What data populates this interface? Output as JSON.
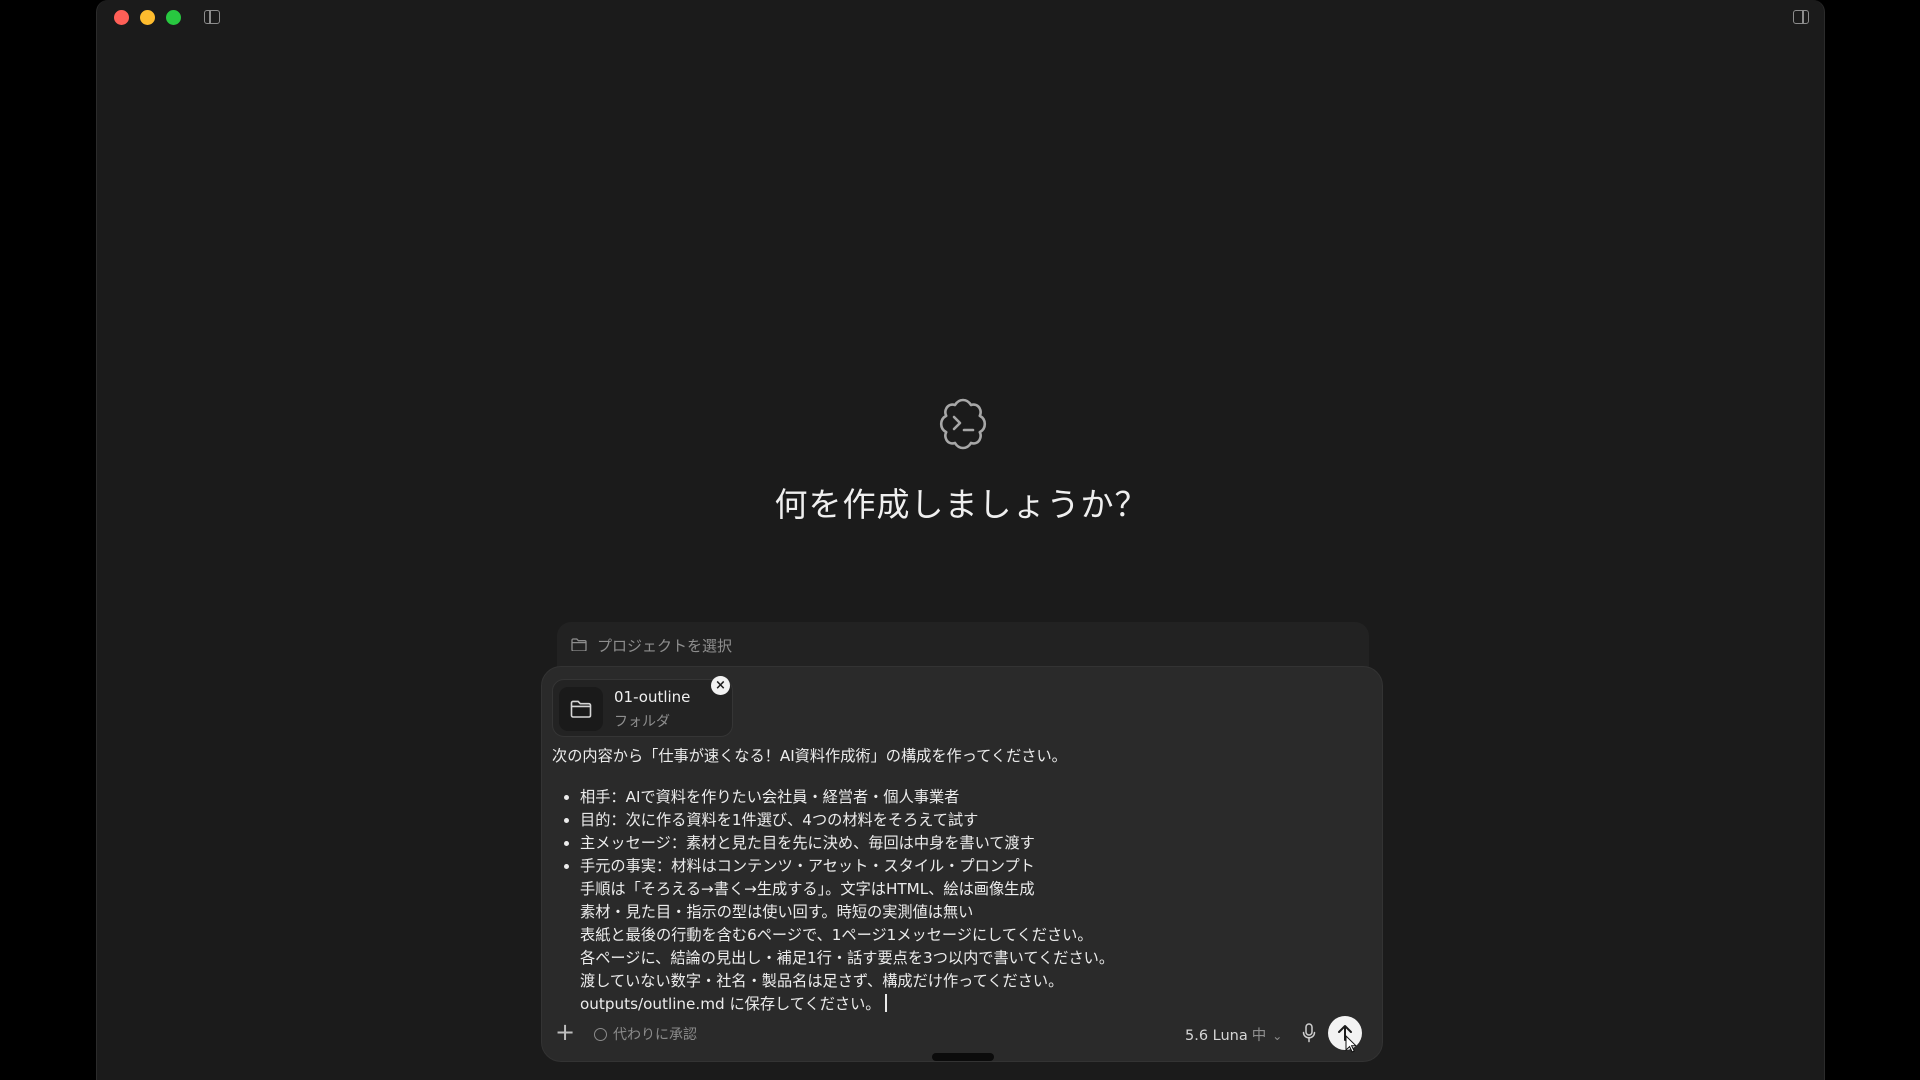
{
  "window": {
    "controls": [
      "close",
      "minimize",
      "maximize"
    ]
  },
  "hero": {
    "logo_icon": "terminal-cloud-icon",
    "headline": "何を作成しましょうか？"
  },
  "project": {
    "icon": "folder-icon",
    "placeholder": "プロジェクトを選択"
  },
  "attachment": {
    "name": "01-outline",
    "kind": "フォルダ",
    "icon": "folder-icon",
    "remove_icon": "close-icon"
  },
  "prompt": {
    "intro": "次の内容から「仕事が速くなる！AI資料作成術」の構成を作ってください。",
    "bullets": [
      "相手：AIで資料を作りたい会社員・経営者・個人事業者",
      "目的：次に作る資料を1件選び、4つの材料をそろえて試す",
      "主メッセージ：素材と見た目を先に決め、毎回は中身を書いて渡す",
      "手元の事実：材料はコンテンツ・アセット・スタイル・プロンプト"
    ],
    "continuation": [
      "手順は「そろえる→書く→生成する」。文字はHTML、絵は画像生成",
      "素材・見た目・指示の型は使い回す。時短の実測値は無い",
      "表紙と最後の行動を含む6ページで、1ページ1メッセージにしてください。",
      "各ページに、結論の見出し・補足1行・話す要点を3つ以内で書いてください。",
      "渡していない数字・社名・製品名は足さず、構成だけ作ってください。",
      "outputs/outline.md に保存してください。"
    ]
  },
  "toolbar": {
    "add_icon": "plus-icon",
    "approve_label": "代わりに承認",
    "model_label": "5.6 Luna",
    "effort_label": "中",
    "mic_icon": "microphone-icon",
    "send_icon": "arrow-up-icon"
  },
  "colors": {
    "background": "#1b1b1b",
    "composer": "#2a2a2a",
    "close": "#ff5f57",
    "minimize": "#febc2e",
    "maximize": "#28c840"
  }
}
